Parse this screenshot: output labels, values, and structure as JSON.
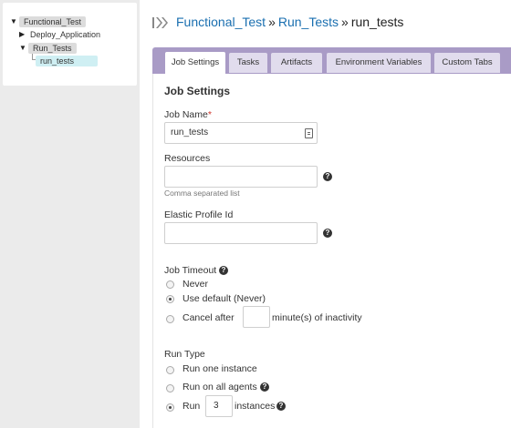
{
  "tree": {
    "items": [
      {
        "label": "Functional_Test"
      },
      {
        "label": "Deploy_Application"
      },
      {
        "label": "Run_Tests"
      },
      {
        "label": "run_tests"
      }
    ]
  },
  "header": {
    "crumb_1": "Functional_Test",
    "sep_1": "»",
    "crumb_2": "Run_Tests",
    "sep_2": "»",
    "current": "run_tests"
  },
  "tabs": [
    {
      "label": "Job Settings"
    },
    {
      "label": "Tasks"
    },
    {
      "label": "Artifacts"
    },
    {
      "label": "Environment Variables"
    },
    {
      "label": "Custom Tabs"
    }
  ],
  "job_settings": {
    "title": "Job Settings",
    "job_name": {
      "label": "Job Name",
      "required_mark": "*",
      "value": "run_tests"
    },
    "resources": {
      "label": "Resources",
      "value": "",
      "help": "Comma separated list"
    },
    "elastic_profile": {
      "label": "Elastic Profile Id",
      "value": ""
    },
    "job_timeout": {
      "label": "Job Timeout",
      "options": {
        "never": "Never",
        "default": "Use default (Never)",
        "cancel_after": "Cancel after",
        "cancel_suffix": "minute(s) of inactivity"
      },
      "selected": "default",
      "minutes_value": ""
    },
    "run_type": {
      "label": "Run Type",
      "options": {
        "one": "Run one instance",
        "all": "Run on all agents",
        "run": "Run",
        "instances_suffix": "instances"
      },
      "selected": "run",
      "instances_value": "3"
    }
  },
  "colors": {
    "link": "#1a6fb0",
    "tab_band": "#a99bc6",
    "tab_inactive": "#e1dced",
    "tree_selected": "#cfeff3",
    "required": "#d0352b"
  }
}
